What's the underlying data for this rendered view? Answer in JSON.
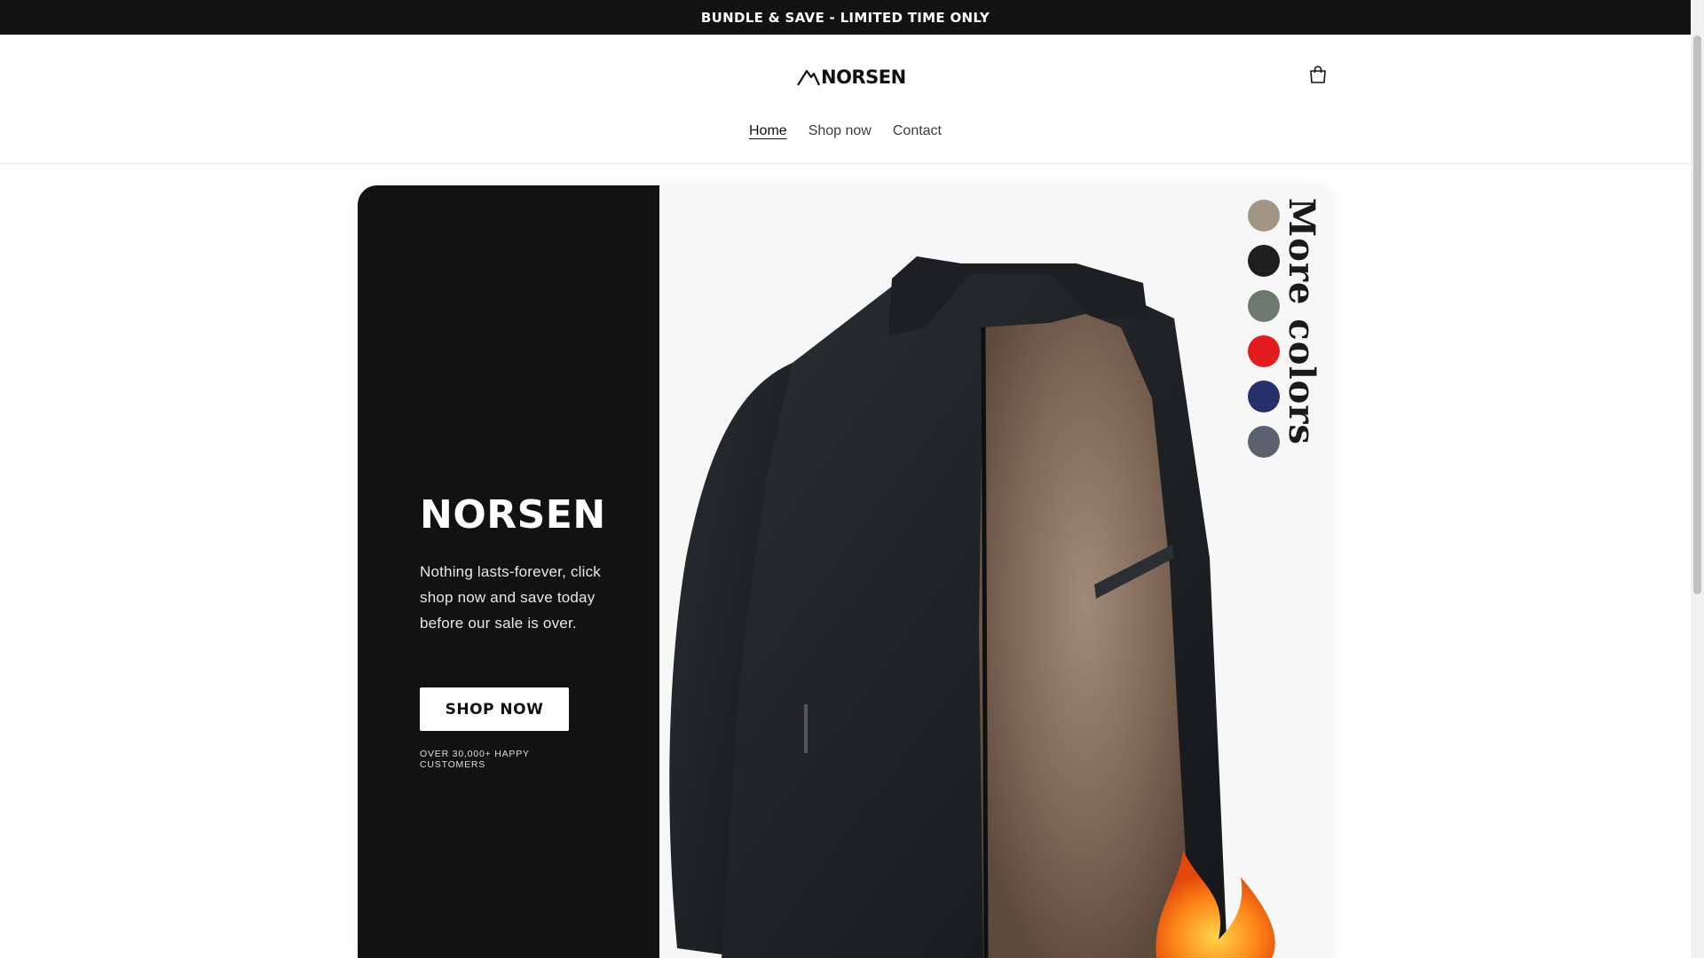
{
  "announcement": {
    "text": "BUNDLE & SAVE - LIMITED TIME ONLY"
  },
  "header": {
    "logo_text": "NORSEN",
    "nav": [
      {
        "label": "Home",
        "active": true
      },
      {
        "label": "Shop now",
        "active": false
      },
      {
        "label": "Contact",
        "active": false
      }
    ],
    "cart_icon": "cart-icon"
  },
  "hero": {
    "title": "NORSEN",
    "text": "Nothing lasts-forever, click shop now and save today before our sale is over.",
    "button_label": "SHOP NOW",
    "note": "OVER 30,000+ HAPPY CUSTOMERS",
    "image": {
      "overlay_text": "More colors",
      "swatches": [
        "#a39585",
        "#1f1f1f",
        "#6e7a70",
        "#e31d1d",
        "#27306b",
        "#5c6170"
      ]
    }
  },
  "colors": {
    "dark": "#121212",
    "white": "#ffffff"
  }
}
